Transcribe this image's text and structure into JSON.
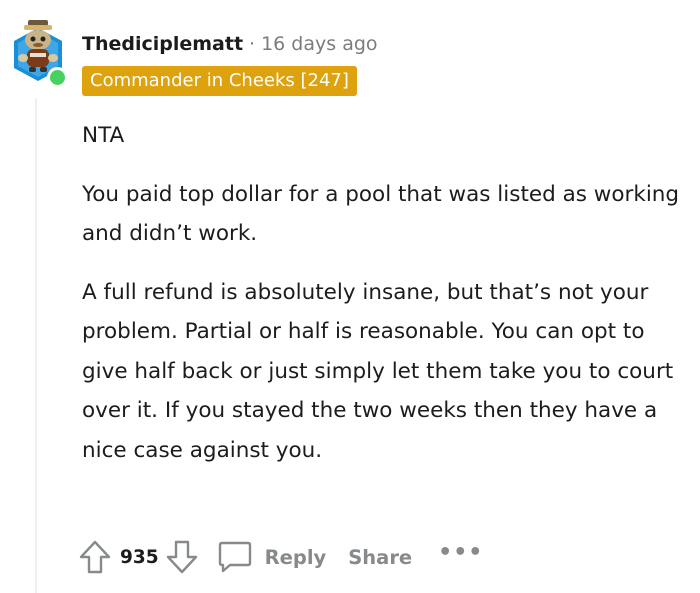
{
  "comment": {
    "author": "Thediciplematt",
    "separator": "·",
    "timestamp": "16 days ago",
    "flair": "Commander in Cheeks [247]",
    "flair_color": "#dda20e",
    "online_status_color": "#46d160",
    "body": [
      "NTA",
      "You paid top dollar for a pool that was listed as working and didn’t work.",
      "A full refund is absolutely insane, but that’s not your problem. Partial or half is reasonable. You can opt to give half back or just simply let them take you to court over it. If you stayed the two weeks then they have a nice case against you."
    ]
  },
  "actions": {
    "upvote_icon": "arrow-up-icon",
    "score": "935",
    "downvote_icon": "arrow-down-icon",
    "comment_icon": "speech-bubble-icon",
    "reply_label": "Reply",
    "share_label": "Share",
    "more_label": "•••"
  }
}
